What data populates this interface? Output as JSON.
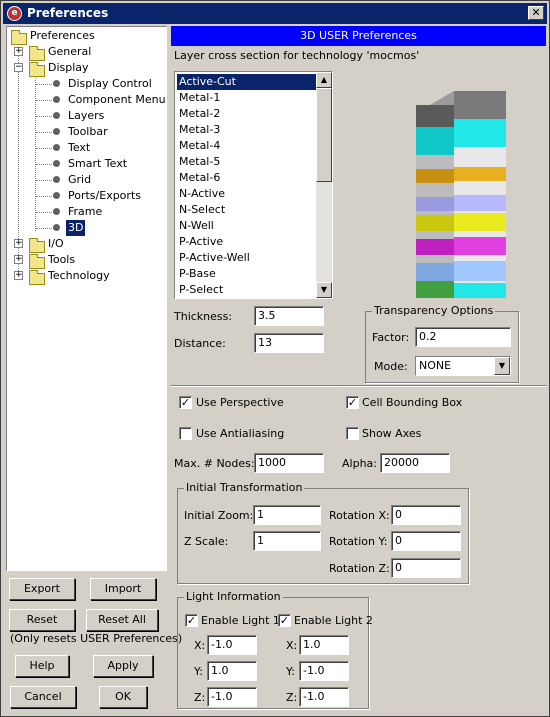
{
  "window": {
    "title": "Preferences"
  },
  "tree": {
    "root": "Preferences",
    "nodes": [
      {
        "label": "General",
        "type": "folder",
        "expanded": false
      },
      {
        "label": "Display",
        "type": "folder",
        "expanded": true
      },
      {
        "label": "Display Control",
        "type": "leaf"
      },
      {
        "label": "Component Menu",
        "type": "leaf"
      },
      {
        "label": "Layers",
        "type": "leaf"
      },
      {
        "label": "Toolbar",
        "type": "leaf"
      },
      {
        "label": "Text",
        "type": "leaf"
      },
      {
        "label": "Smart Text",
        "type": "leaf"
      },
      {
        "label": "Grid",
        "type": "leaf"
      },
      {
        "label": "Ports/Exports",
        "type": "leaf"
      },
      {
        "label": "Frame",
        "type": "leaf"
      },
      {
        "label": "3D",
        "type": "leaf",
        "selected": true
      },
      {
        "label": "I/O",
        "type": "folder",
        "expanded": false
      },
      {
        "label": "Tools",
        "type": "folder",
        "expanded": false
      },
      {
        "label": "Technology",
        "type": "folder",
        "expanded": false
      }
    ]
  },
  "left_buttons": {
    "export": "Export",
    "import": "Import",
    "reset": "Reset",
    "reset_all": "Reset All",
    "note": "(Only resets USER Preferences)",
    "help": "Help",
    "apply": "Apply",
    "cancel": "Cancel",
    "ok": "OK"
  },
  "panel": {
    "header": "3D USER Preferences",
    "subtitle": "Layer cross section for technology 'mocmos'",
    "layers": [
      "Active-Cut",
      "Metal-1",
      "Metal-2",
      "Metal-3",
      "Metal-4",
      "Metal-5",
      "Metal-6",
      "N-Active",
      "N-Select",
      "N-Well",
      "P-Active",
      "P-Active-Well",
      "P-Base",
      "P-Select"
    ],
    "selected_layer": "Active-Cut",
    "thickness_label": "Thickness:",
    "thickness_value": "3.5",
    "distance_label": "Distance:",
    "distance_value": "13",
    "transparency": {
      "title": "Transparency Options",
      "factor_label": "Factor:",
      "factor_value": "0.2",
      "mode_label": "Mode:",
      "mode_value": "NONE"
    },
    "use_perspective": "Use Perspective",
    "cell_bounding_box": "Cell  Bounding Box",
    "use_antialiasing": "Use Antialiasing",
    "show_axes": "Show Axes",
    "max_nodes_label": "Max. # Nodes:",
    "max_nodes_value": "1000",
    "alpha_label": "Alpha:",
    "alpha_value": "20000",
    "initial": {
      "title": "Initial Transformation",
      "zoom_label": "Initial Zoom:",
      "zoom_value": "1",
      "zscale_label": "Z Scale:",
      "zscale_value": "1",
      "rotx_label": "Rotation X:",
      "rotx_value": "0",
      "roty_label": "Rotation Y:",
      "roty_value": "0",
      "rotz_label": "Rotation Z:",
      "rotz_value": "0"
    },
    "light": {
      "title": "Light Information",
      "enable1": "Enable Light 1",
      "enable2": "Enable Light 2",
      "x_label": "X:",
      "y_label": "Y:",
      "z_label": "Z:",
      "x1": "-1.0",
      "y1": "1.0",
      "z1": "-1.0",
      "x2": "1.0",
      "y2": "-1.0",
      "z2": "-1.0"
    }
  },
  "stack_colors": [
    "#7a7a7a",
    "#22e8e8",
    "#d4d4d4",
    "#e8b020",
    "#b8b8ff",
    "#eaea20",
    "#e040e0",
    "#a0c8ff"
  ]
}
